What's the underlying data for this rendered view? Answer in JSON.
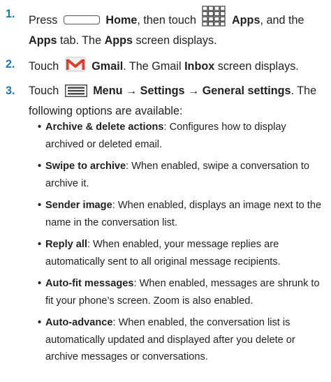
{
  "steps": [
    {
      "number": "1.",
      "t1": "Press",
      "home_label": "Home",
      "t2": ", then touch",
      "apps_label": "Apps",
      "t3": ", and the",
      "apps_tab": "Apps",
      "t4": "tab. The",
      "apps_screen": "Apps",
      "t5": "screen displays."
    },
    {
      "number": "2.",
      "t1": "Touch",
      "gmail_label": "Gmail",
      "t2": ". The Gmail",
      "inbox_label": "Inbox",
      "t3": "screen displays."
    },
    {
      "number": "3.",
      "t1": "Touch",
      "path": "Menu → Settings → General settings",
      "t2": ". The following options are available:"
    }
  ],
  "options": [
    {
      "term": "Archive & delete actions",
      "desc": ": Configures how to display archived or deleted email."
    },
    {
      "term": "Swipe to archive",
      "desc": ": When enabled, swipe a conversation to archive it."
    },
    {
      "term": "Sender image",
      "desc": ": When enabled, displays an image next to the name in the conversation list."
    },
    {
      "term": "Reply all",
      "desc": ": When enabled, your message replies are automatically sent to all original message recipients."
    },
    {
      "term": "Auto-fit messages",
      "desc": ": When enabled, messages are shrunk to fit your phone’s screen. Zoom is also enabled."
    },
    {
      "term": "Auto-advance",
      "desc": ": When enabled, the conversation list is automatically updated and displayed after you delete or archive messages or conversations."
    }
  ],
  "colors": {
    "accent": "#1a78b4",
    "text": "#231f20"
  },
  "icons": [
    "home-key-icon",
    "apps-grid-icon",
    "gmail-icon",
    "menu-icon"
  ]
}
